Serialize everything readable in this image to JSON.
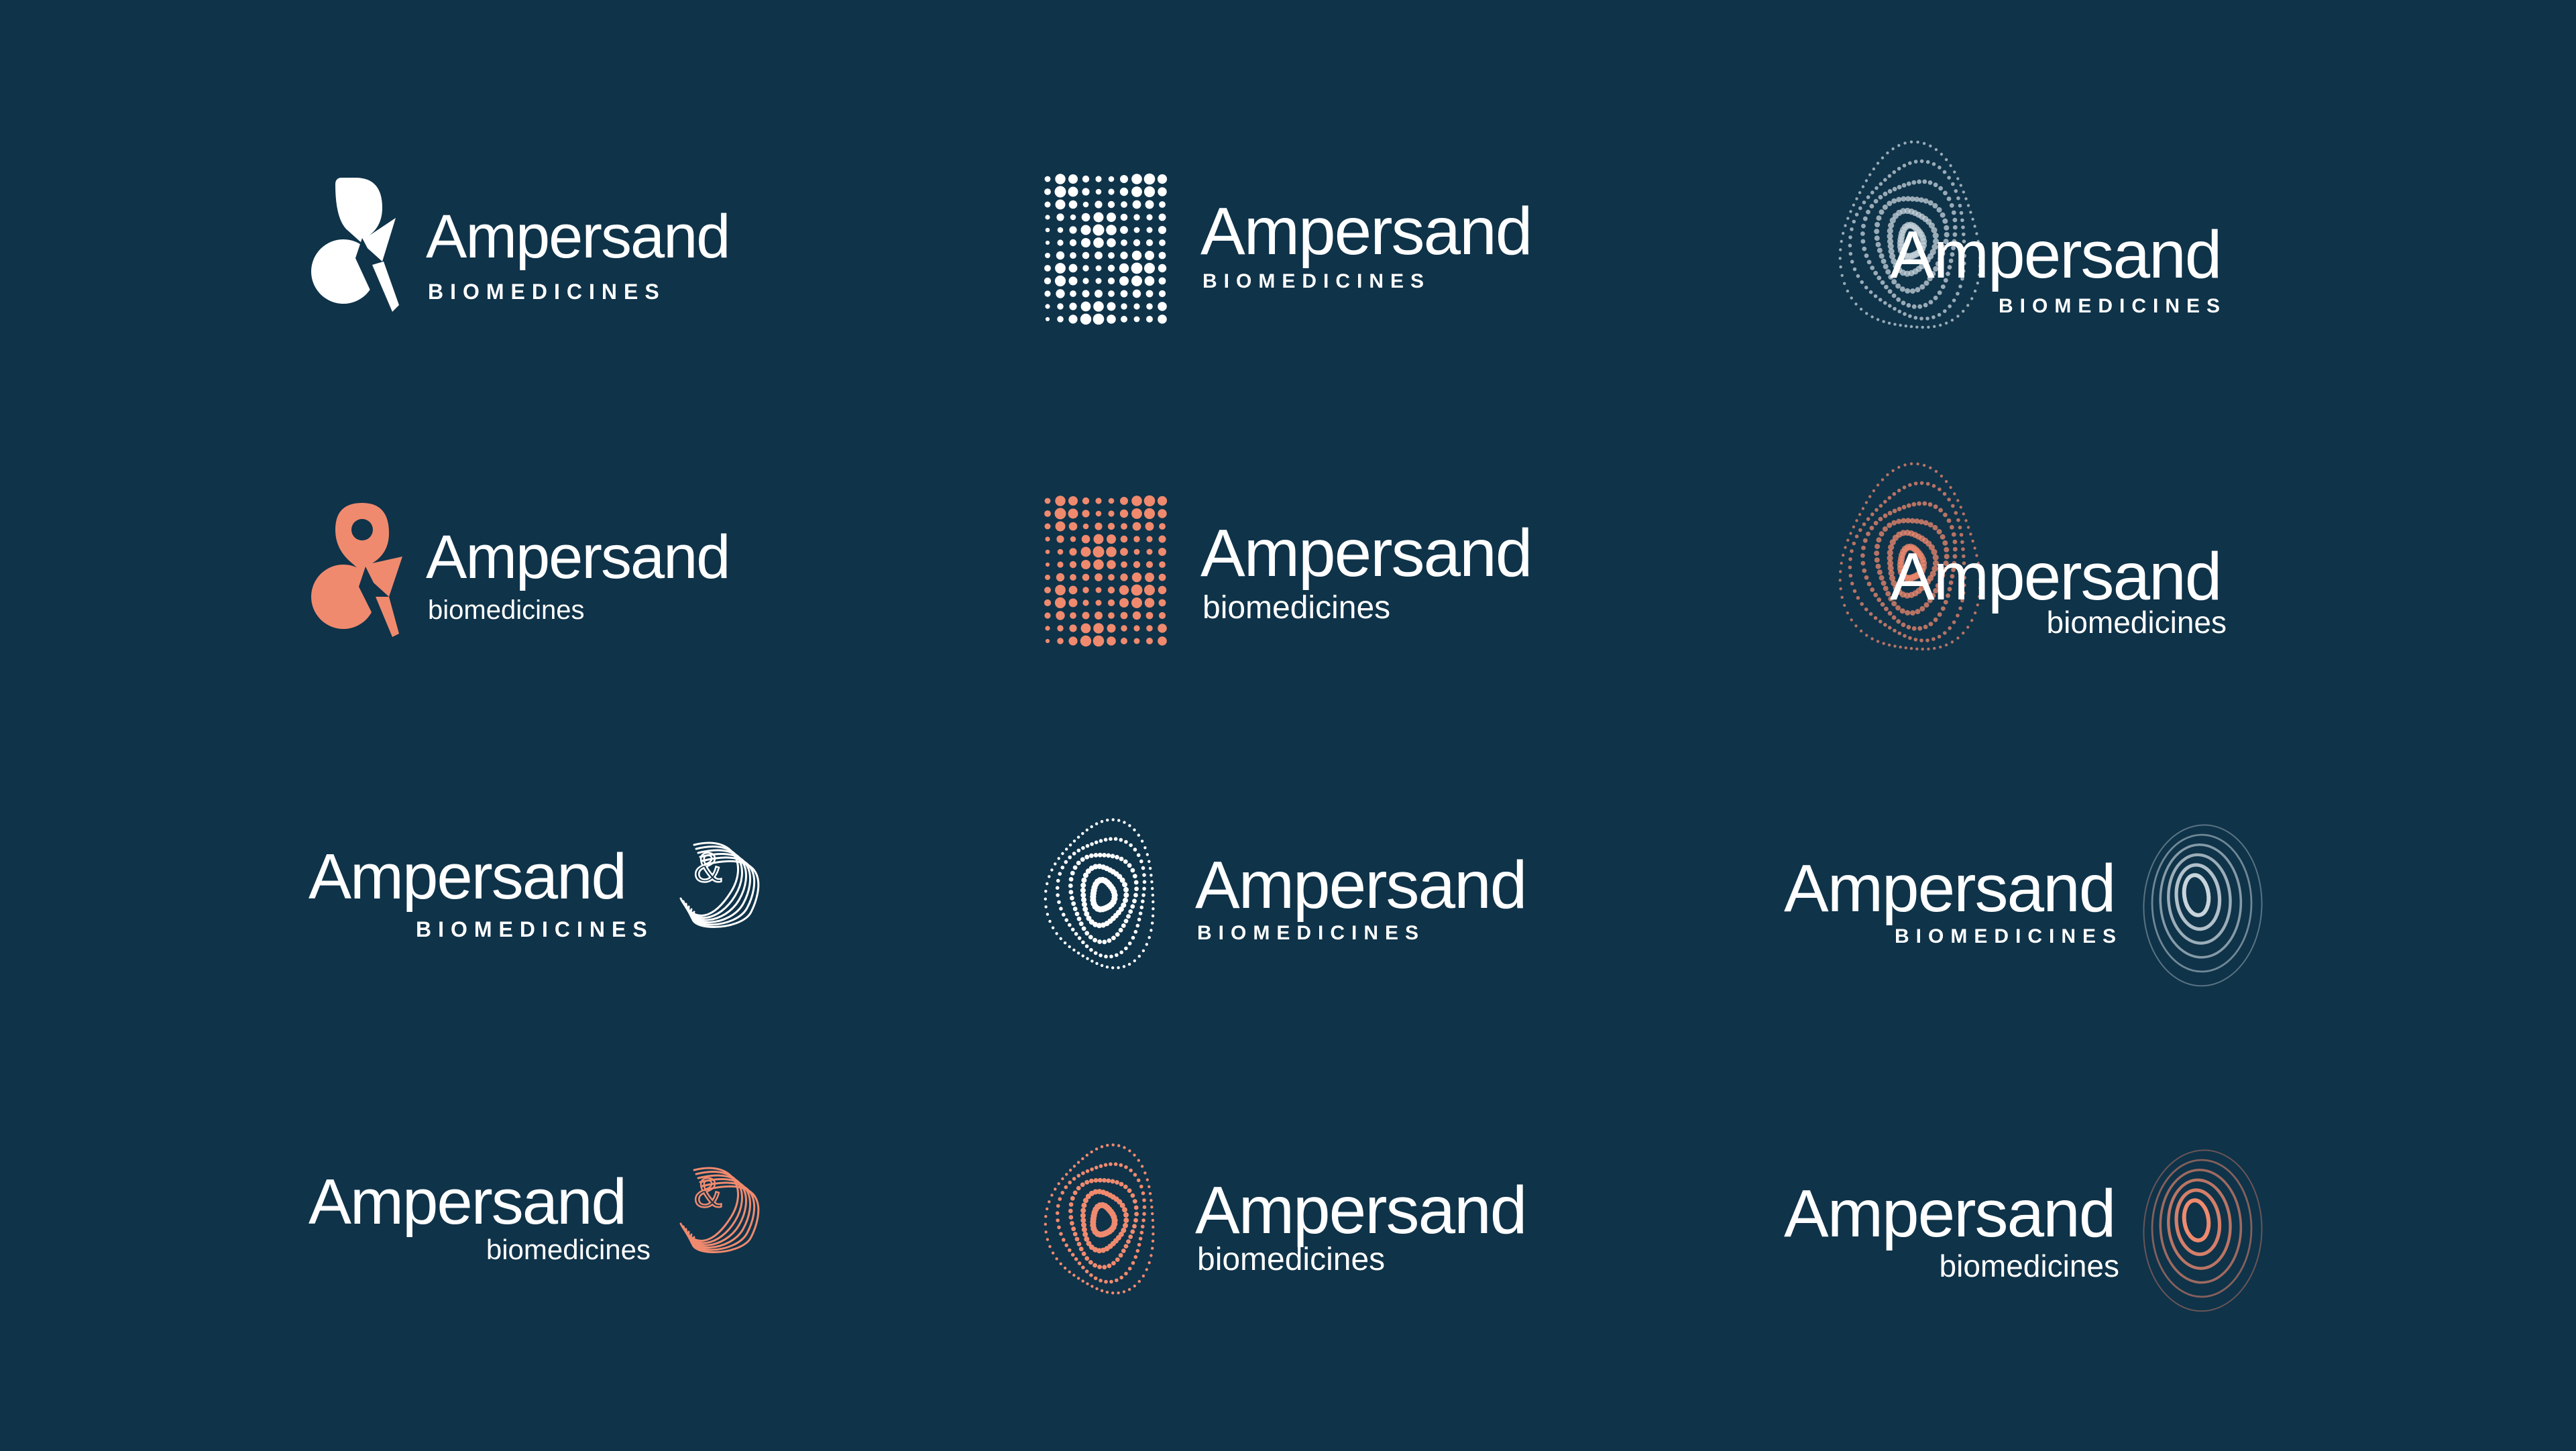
{
  "background_color": "#0f3349",
  "colors": {
    "white": "#ffffff",
    "coral": "#f08a6e",
    "silver": "#c8d4dc"
  },
  "logos": [
    {
      "brand": "Ampersand",
      "tagline": "BIOMEDICINES",
      "mark": "solid-ampersand-icon",
      "color": "white"
    },
    {
      "brand": "Ampersand",
      "tagline": "BIOMEDICINES",
      "mark": "halftone-ampersand-icon",
      "color": "white"
    },
    {
      "brand": "Ampersand",
      "tagline": "BIOMEDICINES",
      "mark": "fingerprint-dots-icon",
      "color": "silver"
    },
    {
      "brand": "Ampersand",
      "tagline": "biomedicines",
      "mark": "solid-ampersand-icon",
      "color": "coral"
    },
    {
      "brand": "Ampersand",
      "tagline": "biomedicines",
      "mark": "halftone-ampersand-icon",
      "color": "coral"
    },
    {
      "brand": "Ampersand",
      "tagline": "biomedicines",
      "mark": "fingerprint-dots-icon",
      "color": "coral"
    },
    {
      "brand": "Ampersand",
      "tagline": "BIOMEDICINES",
      "mark": "contour-lines-icon",
      "color": "white"
    },
    {
      "brand": "Ampersand",
      "tagline": "BIOMEDICINES",
      "mark": "dotted-rings-icon",
      "color": "white"
    },
    {
      "brand": "Ampersand",
      "tagline": "BIOMEDICINES",
      "mark": "gradient-rings-icon",
      "color": "silver"
    },
    {
      "brand": "Ampersand",
      "tagline": "biomedicines",
      "mark": "contour-lines-icon",
      "color": "coral"
    },
    {
      "brand": "Ampersand",
      "tagline": "biomedicines",
      "mark": "dotted-rings-icon",
      "color": "coral"
    },
    {
      "brand": "Ampersand",
      "tagline": "biomedicines",
      "mark": "gradient-rings-icon",
      "color": "coral"
    }
  ]
}
